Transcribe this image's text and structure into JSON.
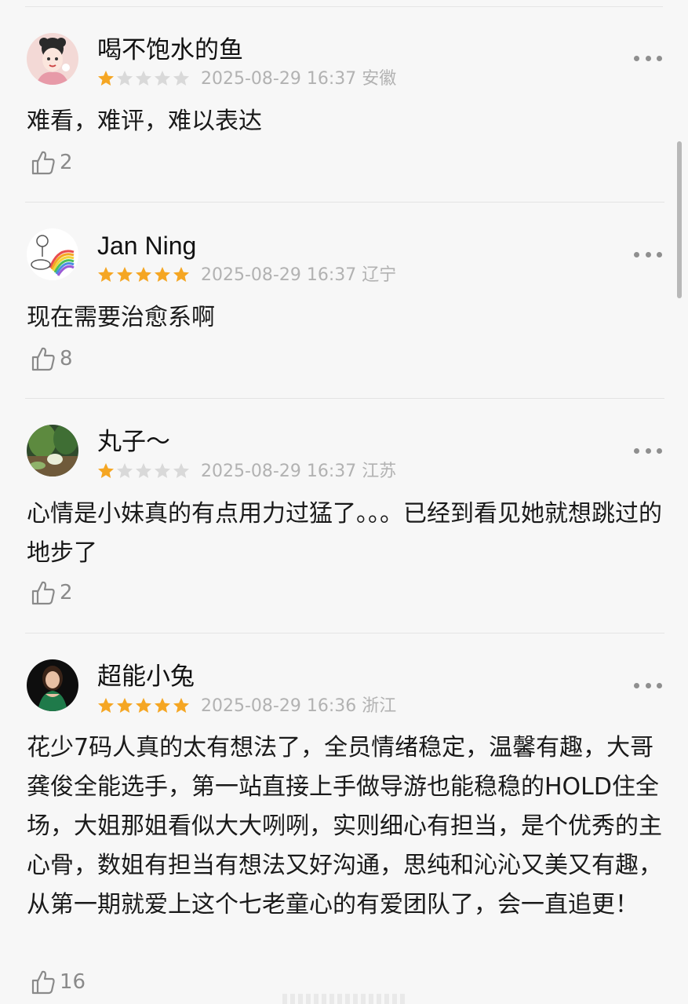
{
  "reviews": [
    {
      "user": "喝不饱水的鱼",
      "rating": 1,
      "max_rating": 5,
      "date": "2025-08-29 16:37",
      "region": "安徽",
      "meta": "2025-08-29 16:37 安徽",
      "content": "难看，难评，难以表达",
      "likes": "2",
      "avatar_icon": "cartoon-girl-avatar"
    },
    {
      "user": "Jan Ning",
      "rating": 5,
      "max_rating": 5,
      "date": "2025-08-29 16:37",
      "region": "辽宁",
      "meta": "2025-08-29 16:37 辽宁",
      "content": "现在需要治愈系啊",
      "likes": "8",
      "avatar_icon": "rainbow-cloud-avatar"
    },
    {
      "user": "丸子～",
      "rating": 1,
      "max_rating": 5,
      "date": "2025-08-29 16:37",
      "region": "江苏",
      "meta": "2025-08-29 16:37 江苏",
      "content": "心情是小妹真的有点用力过猛了。。。已经到看见她就想跳过的地步了",
      "likes": "2",
      "avatar_icon": "forest-scene-avatar"
    },
    {
      "user": "超能小兔",
      "rating": 5,
      "max_rating": 5,
      "date": "2025-08-29 16:36",
      "region": "浙江",
      "meta": "2025-08-29 16:36 浙江",
      "content": "花少7码人真的太有想法了，全员情绪稳定，温馨有趣，大哥龚俊全能选手，第一站直接上手做导游也能稳稳的HOLD住全场，大姐那姐看似大大咧咧，实则细心有担当，是个优秀的主心骨，数姐有担当有想法又好沟通，思纯和沁沁又美又有趣，从第一期就爱上这个七老童心的有爱团队了，会一直追更！",
      "likes": "16",
      "avatar_icon": "woman-portrait-avatar"
    }
  ],
  "colors": {
    "star_filled": "#f5a623",
    "star_empty": "#d9d9d9",
    "meta_text": "#b2b2b2",
    "background": "#f7f7f7"
  },
  "icons": {
    "more": "more-dots-icon",
    "like": "thumbs-up-icon",
    "star": "star-icon"
  }
}
